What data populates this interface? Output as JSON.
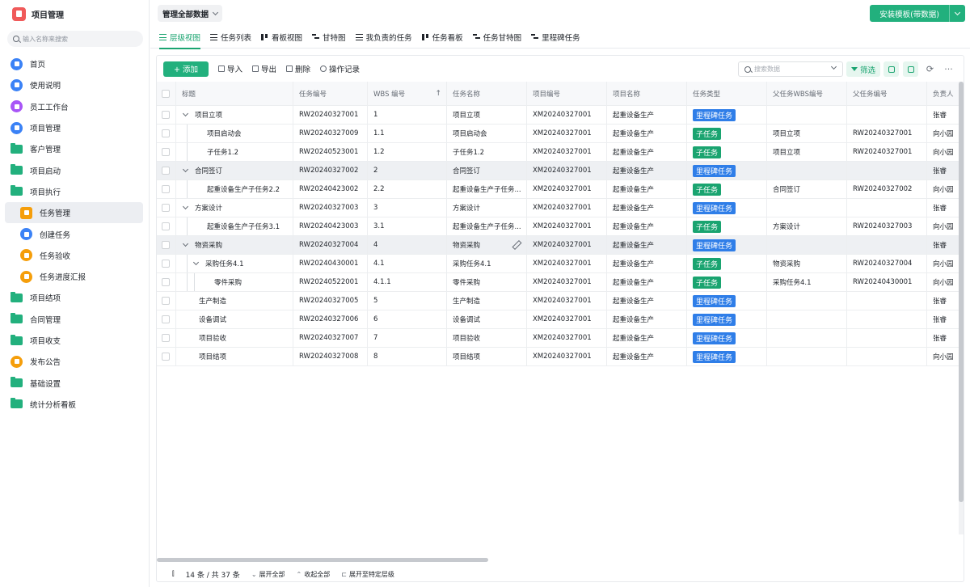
{
  "app": {
    "title": "项目管理"
  },
  "sidebar": {
    "search_placeholder": "输入名称来搜索",
    "items": [
      {
        "label": "首页",
        "icon": "home-icon",
        "type": "circle-blue"
      },
      {
        "label": "使用说明",
        "icon": "document-icon",
        "type": "circle-blue"
      },
      {
        "label": "员工工作台",
        "icon": "user-icon",
        "type": "circle-purple"
      },
      {
        "label": "项目管理",
        "icon": "document-icon",
        "type": "circle-blue"
      },
      {
        "label": "客户管理",
        "icon": "folder-icon",
        "type": "folder"
      },
      {
        "label": "项目启动",
        "icon": "folder-icon",
        "type": "folder"
      },
      {
        "label": "项目执行",
        "icon": "folder-icon",
        "type": "folder"
      },
      {
        "label": "任务管理",
        "icon": "task-icon",
        "type": "sub-orange",
        "active": true
      },
      {
        "label": "创建任务",
        "icon": "send-icon",
        "type": "sub-blue"
      },
      {
        "label": "任务验收",
        "icon": "shield-icon",
        "type": "sub-orange"
      },
      {
        "label": "任务进度汇报",
        "icon": "shield-icon",
        "type": "sub-orange"
      },
      {
        "label": "项目结项",
        "icon": "folder-icon",
        "type": "folder"
      },
      {
        "label": "合同管理",
        "icon": "folder-icon",
        "type": "folder"
      },
      {
        "label": "项目收支",
        "icon": "folder-icon",
        "type": "folder"
      },
      {
        "label": "发布公告",
        "icon": "megaphone-icon",
        "type": "circle-orange"
      },
      {
        "label": "基础设置",
        "icon": "folder-icon",
        "type": "folder"
      },
      {
        "label": "统计分析看板",
        "icon": "folder-icon",
        "type": "folder"
      }
    ]
  },
  "topbar": {
    "scope": "管理全部数据",
    "install_label": "安装模板(带数据)"
  },
  "tabs": [
    {
      "label": "层级视图",
      "icon": "lines",
      "active": true
    },
    {
      "label": "任务列表",
      "icon": "lines"
    },
    {
      "label": "看板视图",
      "icon": "kanban"
    },
    {
      "label": "甘特图",
      "icon": "gantt"
    },
    {
      "label": "我负责的任务",
      "icon": "lines"
    },
    {
      "label": "任务看板",
      "icon": "kanban"
    },
    {
      "label": "任务甘特图",
      "icon": "gantt"
    },
    {
      "label": "里程碑任务",
      "icon": "gantt"
    }
  ],
  "toolbar": {
    "add_label": "+ 添加",
    "import_label": "导入",
    "export_label": "导出",
    "delete_label": "删除",
    "log_label": "操作记录",
    "search_placeholder": "搜索数据",
    "filter_label": "筛选"
  },
  "table": {
    "columns": [
      "标题",
      "任务编号",
      "WBS 编号",
      "任务名称",
      "项目编号",
      "项目名称",
      "任务类型",
      "父任务WBS编号",
      "父任务编号",
      "负责人"
    ],
    "rows": [
      {
        "level": 0,
        "caret": true,
        "group": false,
        "title": "项目立项",
        "code": "RW20240327001",
        "wbs": "1",
        "name": "项目立项",
        "proj": "XM20240327001",
        "pname": "起重设备生产",
        "type": "里程碑任务",
        "type_kind": "milestone",
        "pwbs": "",
        "pcode": "",
        "owner": "张睿"
      },
      {
        "level": 1,
        "caret": false,
        "group": false,
        "title": "项目启动会",
        "code": "RW20240327009",
        "wbs": "1.1",
        "name": "项目启动会",
        "proj": "XM20240327001",
        "pname": "起重设备生产",
        "type": "子任务",
        "type_kind": "child",
        "pwbs": "项目立项",
        "pcode": "RW20240327001",
        "owner": "向小园"
      },
      {
        "level": 1,
        "caret": false,
        "group": false,
        "title": "子任务1.2",
        "code": "RW20240523001",
        "wbs": "1.2",
        "name": "子任务1.2",
        "proj": "XM20240327001",
        "pname": "起重设备生产",
        "type": "子任务",
        "type_kind": "child",
        "pwbs": "项目立项",
        "pcode": "RW20240327001",
        "owner": "向小园"
      },
      {
        "level": 0,
        "caret": true,
        "group": true,
        "title": "合同签订",
        "code": "RW20240327002",
        "wbs": "2",
        "name": "合同签订",
        "proj": "XM20240327001",
        "pname": "起重设备生产",
        "type": "里程碑任务",
        "type_kind": "milestone",
        "pwbs": "",
        "pcode": "",
        "owner": "张睿"
      },
      {
        "level": 1,
        "caret": false,
        "group": false,
        "title": "起重设备生产子任务2.2",
        "code": "RW20240423002",
        "wbs": "2.2",
        "name": "起重设备生产子任务...",
        "proj": "XM20240327001",
        "pname": "起重设备生产",
        "type": "子任务",
        "type_kind": "child",
        "pwbs": "合同签订",
        "pcode": "RW20240327002",
        "owner": "向小园"
      },
      {
        "level": 0,
        "caret": true,
        "group": false,
        "title": "方案设计",
        "code": "RW20240327003",
        "wbs": "3",
        "name": "方案设计",
        "proj": "XM20240327001",
        "pname": "起重设备生产",
        "type": "里程碑任务",
        "type_kind": "milestone",
        "pwbs": "",
        "pcode": "",
        "owner": "张睿"
      },
      {
        "level": 1,
        "caret": false,
        "group": false,
        "title": "起重设备生产子任务3.1",
        "code": "RW20240423003",
        "wbs": "3.1",
        "name": "起重设备生产子任务...",
        "proj": "XM20240327001",
        "pname": "起重设备生产",
        "type": "子任务",
        "type_kind": "child",
        "pwbs": "方案设计",
        "pcode": "RW20240327003",
        "owner": "向小园"
      },
      {
        "level": 0,
        "caret": true,
        "group": true,
        "edit": true,
        "title": "物资采购",
        "code": "RW20240327004",
        "wbs": "4",
        "name": "物资采购",
        "proj": "XM20240327001",
        "pname": "起重设备生产",
        "type": "里程碑任务",
        "type_kind": "milestone",
        "pwbs": "",
        "pcode": "",
        "owner": "张睿"
      },
      {
        "level": 1,
        "caret": true,
        "group": false,
        "title": "采购任务4.1",
        "code": "RW20240430001",
        "wbs": "4.1",
        "name": "采购任务4.1",
        "proj": "XM20240327001",
        "pname": "起重设备生产",
        "type": "子任务",
        "type_kind": "child",
        "pwbs": "物资采购",
        "pcode": "RW20240327004",
        "owner": "向小园"
      },
      {
        "level": 2,
        "caret": false,
        "group": false,
        "title": "零件采购",
        "code": "RW20240522001",
        "wbs": "4.1.1",
        "name": "零件采购",
        "proj": "XM20240327001",
        "pname": "起重设备生产",
        "type": "子任务",
        "type_kind": "child",
        "pwbs": "采购任务4.1",
        "pcode": "RW20240430001",
        "owner": "向小园"
      },
      {
        "level": 0,
        "caret": false,
        "group": false,
        "title": "生产制造",
        "code": "RW20240327005",
        "wbs": "5",
        "name": "生产制造",
        "proj": "XM20240327001",
        "pname": "起重设备生产",
        "type": "里程碑任务",
        "type_kind": "milestone",
        "pwbs": "",
        "pcode": "",
        "owner": "张睿"
      },
      {
        "level": 0,
        "caret": false,
        "group": false,
        "title": "设备调试",
        "code": "RW20240327006",
        "wbs": "6",
        "name": "设备调试",
        "proj": "XM20240327001",
        "pname": "起重设备生产",
        "type": "里程碑任务",
        "type_kind": "milestone",
        "pwbs": "",
        "pcode": "",
        "owner": "张睿"
      },
      {
        "level": 0,
        "caret": false,
        "group": false,
        "title": "项目验收",
        "code": "RW20240327007",
        "wbs": "7",
        "name": "项目验收",
        "proj": "XM20240327001",
        "pname": "起重设备生产",
        "type": "里程碑任务",
        "type_kind": "milestone",
        "pwbs": "",
        "pcode": "",
        "owner": "张睿"
      },
      {
        "level": 0,
        "caret": false,
        "group": false,
        "title": "项目结项",
        "code": "RW20240327008",
        "wbs": "8",
        "name": "项目结项",
        "proj": "XM20240327001",
        "pname": "起重设备生产",
        "type": "里程碑任务",
        "type_kind": "milestone",
        "pwbs": "",
        "pcode": "",
        "owner": "向小园"
      }
    ]
  },
  "footer": {
    "count": "14 条 / 共 37 条",
    "expand_all": "展开全部",
    "collapse_all": "收起全部",
    "expand_to_level": "展开至特定层级"
  },
  "colors": {
    "accent": "#22b07d",
    "milestone": "#2f7ee8",
    "child": "#1aa470"
  }
}
